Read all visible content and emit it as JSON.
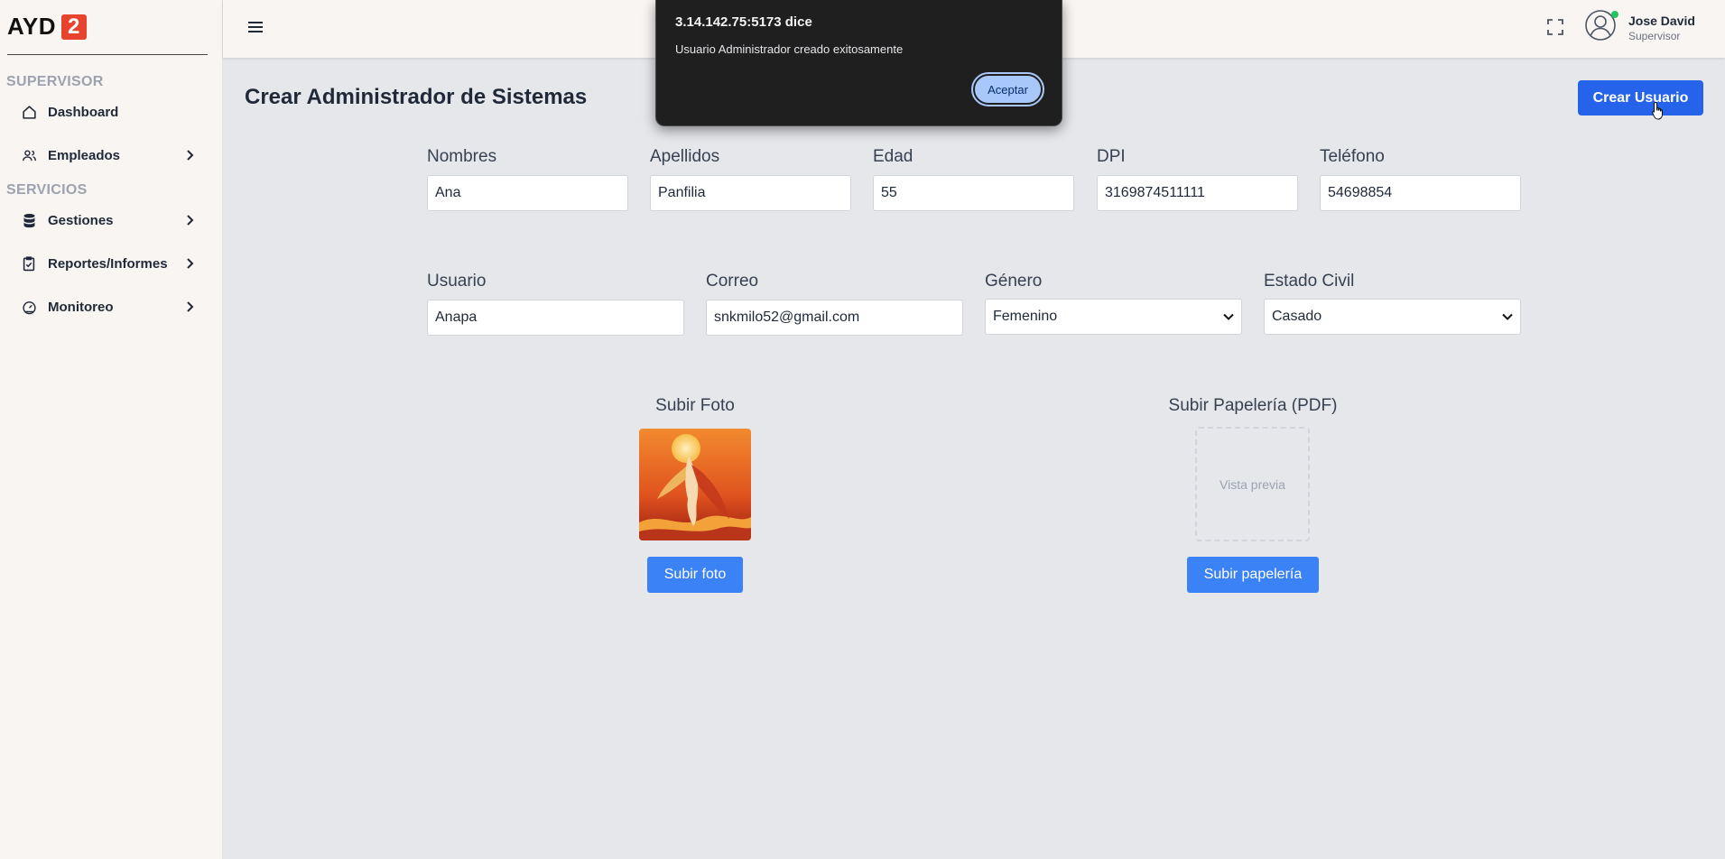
{
  "sidebar": {
    "logo_text": "AYD",
    "logo_badge": "2",
    "sections": [
      {
        "label": "SUPERVISOR"
      },
      {
        "label": "SERVICIOS"
      }
    ],
    "items": [
      {
        "label": "Dashboard",
        "icon": "home-icon"
      },
      {
        "label": "Empleados",
        "icon": "users-icon"
      },
      {
        "label": "Gestiones",
        "icon": "database-icon"
      },
      {
        "label": "Reportes/Informes",
        "icon": "clipboard-check-icon"
      },
      {
        "label": "Monitoreo",
        "icon": "gauge-icon"
      }
    ]
  },
  "header": {
    "user_name": "Jose David",
    "user_role": "Supervisor"
  },
  "page": {
    "title": "Crear Administrador de Sistemas",
    "create_button": "Crear Usuario"
  },
  "form": {
    "nombres": {
      "label": "Nombres",
      "value": "Ana"
    },
    "apellidos": {
      "label": "Apellidos",
      "value": "Panfilia"
    },
    "edad": {
      "label": "Edad",
      "value": "55"
    },
    "dpi": {
      "label": "DPI",
      "value": "3169874511111"
    },
    "telefono": {
      "label": "Teléfono",
      "value": "54698854"
    },
    "usuario": {
      "label": "Usuario",
      "value": "Anapa"
    },
    "correo": {
      "label": "Correo",
      "value": "snkmilo52@gmail.com"
    },
    "genero": {
      "label": "Género",
      "value": "Femenino"
    },
    "estado_civil": {
      "label": "Estado Civil",
      "value": "Casado"
    }
  },
  "uploads": {
    "photo_title": "Subir Foto",
    "photo_button": "Subir foto",
    "pdf_title": "Subir Papelería (PDF)",
    "pdf_preview": "Vista previa",
    "pdf_button": "Subir papelería"
  },
  "dialog": {
    "title": "3.14.142.75:5173 dice",
    "message": "Usuario Administrador creado exitosamente",
    "button": "Aceptar"
  },
  "colors": {
    "primary": "#2563eb",
    "upload_button": "#3b82f6",
    "logo_badge": "#e8432d",
    "online": "#22c55e"
  }
}
